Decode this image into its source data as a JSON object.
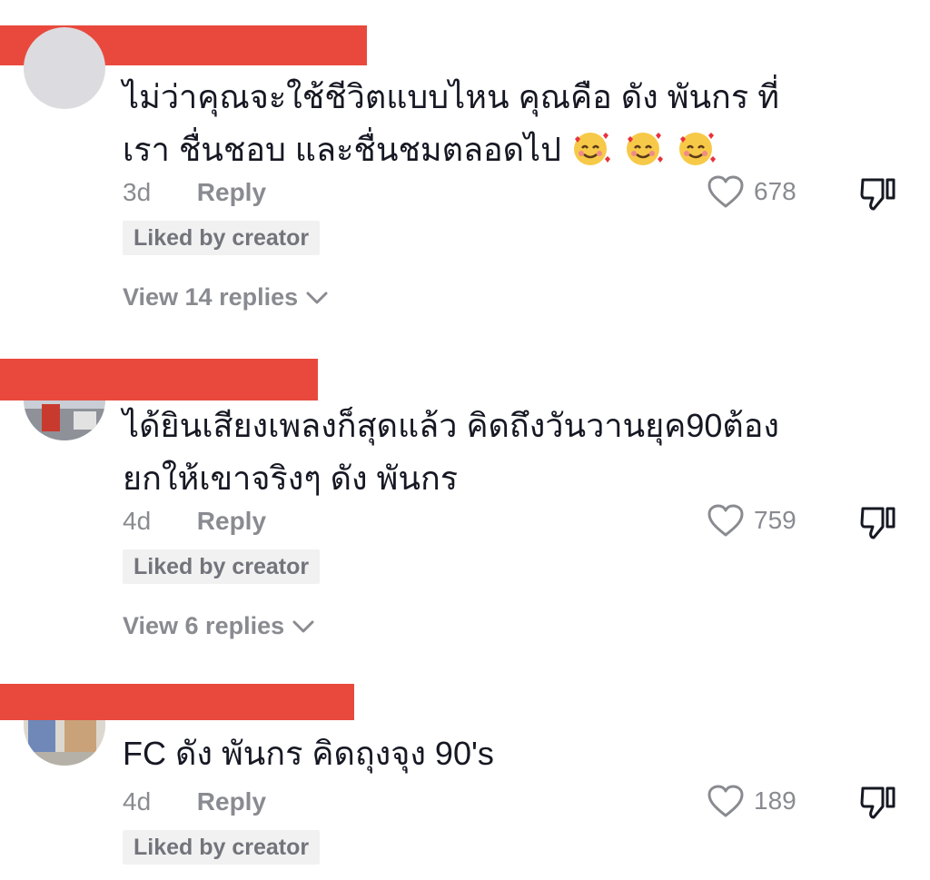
{
  "comments": [
    {
      "text": "ไม่ว่าคุณจะใช้ชีวิตแบบไหน คุณคือ ดัง พันกร ที่เรา ชื่นชอบ และชื่นชมตลอดไป",
      "emoji": [
        "smiling-face-with-hearts-icon",
        "smiling-face-with-hearts-icon",
        "smiling-face-with-hearts-icon"
      ],
      "time": "3d",
      "reply_label": "Reply",
      "likes": "678",
      "badge": "Liked by creator",
      "view_replies": "View 14 replies"
    },
    {
      "text": "ได้ยินเสียงเพลงก็สุดแล้ว คิดถึงวันวานยุค90ต้อง ยกให้เขาจริงๆ ดัง พันกร",
      "time": "4d",
      "reply_label": "Reply",
      "likes": "759",
      "badge": "Liked by creator",
      "view_replies": "View 6 replies"
    },
    {
      "text": "FC ดัง พันกร คิดถุงจุง 90's",
      "time": "4d",
      "reply_label": "Reply",
      "likes": "189",
      "badge": "Liked by creator"
    }
  ],
  "colors": {
    "redaction": "#e9493d",
    "text": "#161823",
    "muted": "#8a8b91",
    "badge_bg": "#f1f1f2"
  }
}
